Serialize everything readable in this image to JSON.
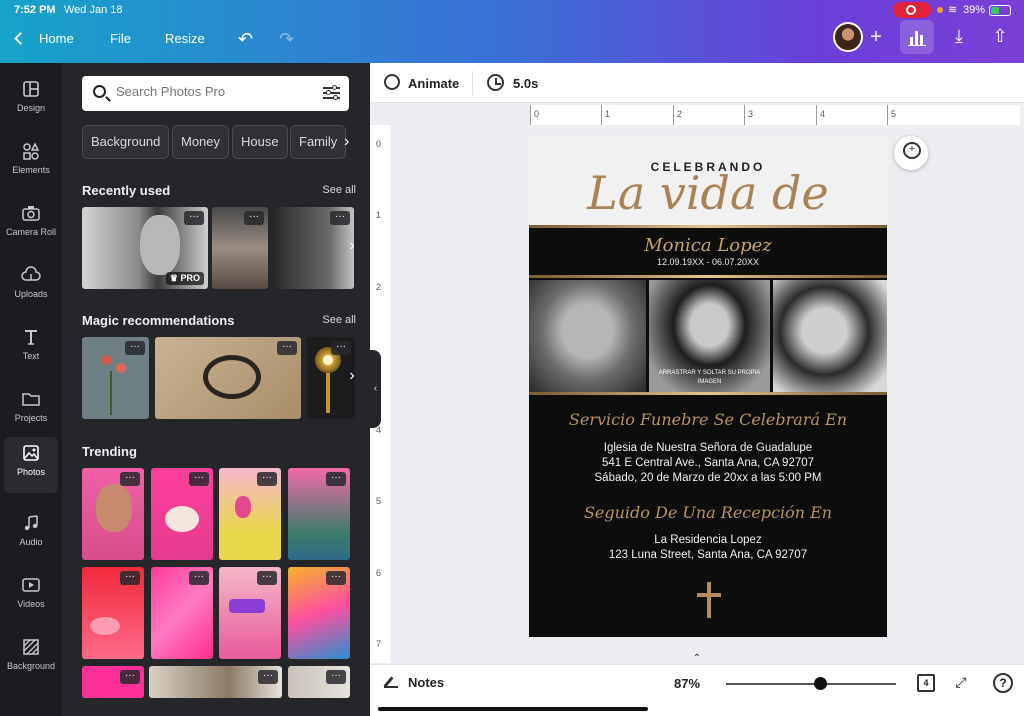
{
  "status_bar": {
    "time": "7:52 PM",
    "date": "Wed Jan 18",
    "wifi": "wifi-icon",
    "battery": "39%"
  },
  "topbar": {
    "back_label": "Home",
    "file_label": "File",
    "resize_label": "Resize",
    "undo_icon": "undo-icon",
    "redo_icon": "redo-icon",
    "plus_label": "+"
  },
  "sidebar": {
    "items": [
      {
        "label": "Design",
        "icon": "design-icon"
      },
      {
        "label": "Elements",
        "icon": "elements-icon"
      },
      {
        "label": "Camera Roll",
        "icon": "camera-icon"
      },
      {
        "label": "Uploads",
        "icon": "upload-icon"
      },
      {
        "label": "Text",
        "icon": "text-icon"
      },
      {
        "label": "Projects",
        "icon": "folder-icon"
      },
      {
        "label": "Photos",
        "icon": "photos-icon",
        "active": true
      },
      {
        "label": "Audio",
        "icon": "audio-icon"
      },
      {
        "label": "Videos",
        "icon": "video-icon"
      },
      {
        "label": "Background",
        "icon": "background-icon"
      }
    ]
  },
  "panel": {
    "search": {
      "placeholder": "Search Photos Pro"
    },
    "chips": [
      "Background",
      "Money",
      "House",
      "Family"
    ],
    "sections": {
      "recently_used": {
        "title": "Recently used",
        "see_all": "See all",
        "pro_badge": "PRO"
      },
      "magic": {
        "title": "Magic recommendations",
        "see_all": "See all"
      },
      "trending": {
        "title": "Trending"
      }
    },
    "more_label": "···"
  },
  "canvas_toolbar": {
    "animate_label": "Animate",
    "duration_label": "5.0s"
  },
  "rulers": {
    "top": [
      "0",
      "1",
      "2",
      "3",
      "4",
      "5"
    ],
    "left": [
      "0",
      "1",
      "2",
      "3",
      "4",
      "5",
      "6",
      "7"
    ]
  },
  "design": {
    "celebrando": "CELEBRANDO",
    "script_title": "La vida de",
    "name": "Monica Lopez",
    "dates": "12.09.19XX - 06.07.20XX",
    "photo_caption": "ARRASTRAR Y SOLTAR SU PROPIA IMAGEN",
    "service_heading": "Servicio Funebre Se Celebrará En",
    "service_lines": [
      "Iglesia de Nuestra Señora de Guadalupe",
      "541 E Central Ave., Santa Ana, CA 92707",
      "Sábado, 20 de Marzo de 20xx a las 5:00 PM"
    ],
    "reception_heading": "Seguido De Una Recepción En",
    "reception_lines": [
      "La Residencia Lopez",
      "123 Luna Street, Santa Ana, CA 92707"
    ],
    "colors": {
      "gold": "#b9935f",
      "page_bg": "#0d0d0d",
      "header_bg": "#f1f1f1"
    }
  },
  "bottombar": {
    "notes_label": "Notes",
    "zoom": "87%",
    "zoom_value": 0.55,
    "page_count": "4",
    "help": "?"
  },
  "colors": {
    "accent_gradient_start": "#17a3c9",
    "accent_gradient_end": "#7b3fd6",
    "rail_bg": "#1b1c1f",
    "panel_bg": "#25262a"
  }
}
